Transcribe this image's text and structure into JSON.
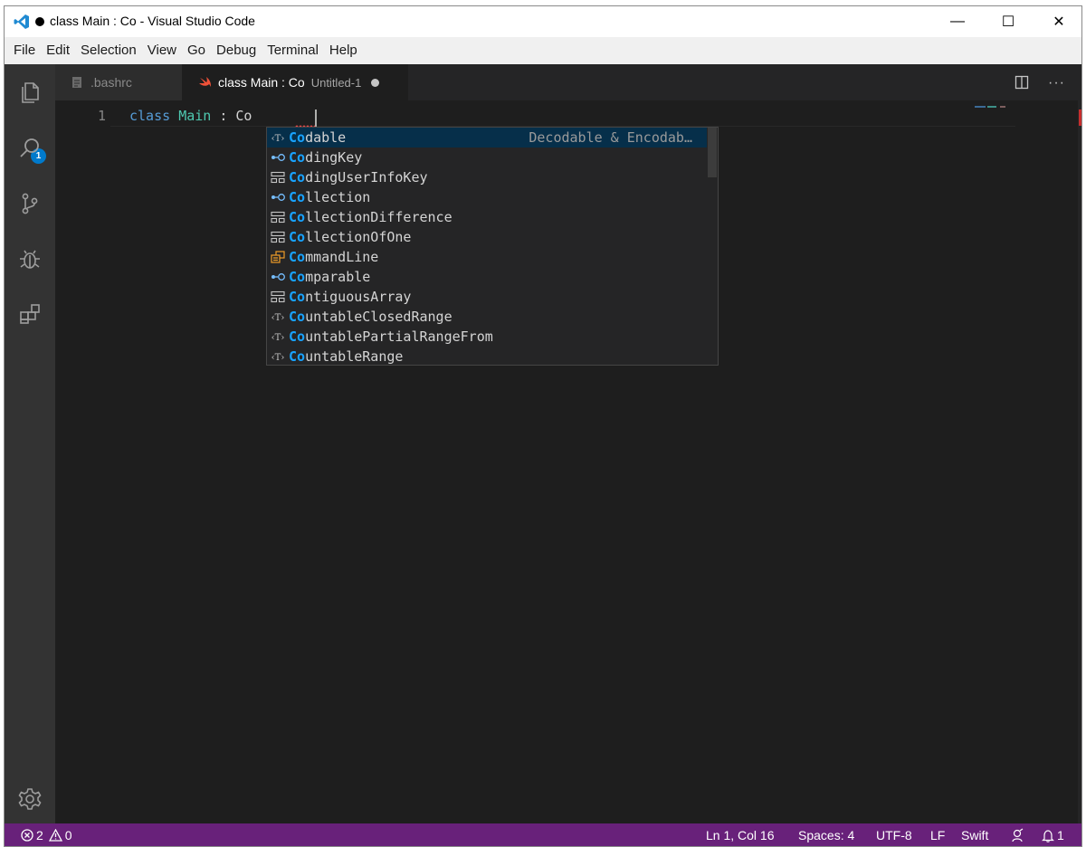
{
  "window": {
    "title": "class Main : Co - Visual Studio Code",
    "controls": {
      "minimize": "—",
      "maximize": "☐",
      "close": "✕"
    }
  },
  "menubar": [
    "File",
    "Edit",
    "Selection",
    "View",
    "Go",
    "Debug",
    "Terminal",
    "Help"
  ],
  "activity_bar": {
    "explorer_badge": "1",
    "icons": [
      "files-icon",
      "search-icon",
      "source-control-icon",
      "debug-icon",
      "extensions-icon",
      "settings-gear-icon"
    ]
  },
  "tabs": [
    {
      "label": ".bashrc",
      "active": false
    },
    {
      "label": "class Main : Co",
      "description": "Untitled-1",
      "active": true,
      "dirty": true
    }
  ],
  "editor_actions": {
    "more": "···"
  },
  "editor": {
    "line_number": "1",
    "tokens": {
      "keyword": "class",
      "type_name": "Main",
      "colon": ":",
      "typed": "Co"
    }
  },
  "suggestions": {
    "match_prefix": "Co",
    "selected_detail": "Decodable & Encodab…",
    "items": [
      {
        "rest": "dable",
        "kind": "typealias",
        "selected": true
      },
      {
        "rest": "dingKey",
        "kind": "protocol"
      },
      {
        "rest": "dingUserInfoKey",
        "kind": "struct"
      },
      {
        "rest": "llection",
        "kind": "protocol"
      },
      {
        "rest": "llectionDifference",
        "kind": "struct"
      },
      {
        "rest": "llectionOfOne",
        "kind": "struct"
      },
      {
        "rest": "mmandLine",
        "kind": "enum"
      },
      {
        "rest": "mparable",
        "kind": "protocol"
      },
      {
        "rest": "ntiguousArray",
        "kind": "struct"
      },
      {
        "rest": "untableClosedRange",
        "kind": "typealias"
      },
      {
        "rest": "untablePartialRangeFrom",
        "kind": "typealias"
      },
      {
        "rest": "untableRange",
        "kind": "typealias"
      }
    ]
  },
  "statusbar": {
    "errors": "2",
    "warnings": "0",
    "position": "Ln 1, Col 16",
    "indent": "Spaces: 4",
    "encoding": "UTF-8",
    "eol": "LF",
    "language": "Swift",
    "notifications": "1"
  },
  "colors": {
    "statusbar_bg": "#68217a",
    "accent_blue": "#007acc",
    "match_highlight": "#18a3ff",
    "selected_row": "#062f4a"
  }
}
